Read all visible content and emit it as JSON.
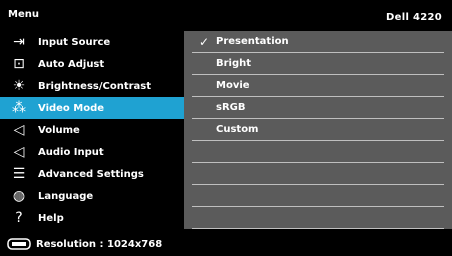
{
  "header": {
    "title": "Menu",
    "model": "Dell 4220"
  },
  "menu": [
    {
      "label": "Input Source",
      "icon": "input-source-icon",
      "glyph": "⇥"
    },
    {
      "label": "Auto Adjust",
      "icon": "auto-adjust-icon",
      "glyph": "⊡"
    },
    {
      "label": "Brightness/Contrast",
      "icon": "brightness-icon",
      "glyph": "☀"
    },
    {
      "label": "Video Mode",
      "icon": "video-mode-icon",
      "glyph": "⁂",
      "selected": true
    },
    {
      "label": "Volume",
      "icon": "volume-icon",
      "glyph": "◁"
    },
    {
      "label": "Audio Input",
      "icon": "audio-input-icon",
      "glyph": "◁"
    },
    {
      "label": "Advanced Settings",
      "icon": "advanced-settings-icon",
      "glyph": "☰"
    },
    {
      "label": "Language",
      "icon": "language-icon",
      "glyph": "◍"
    },
    {
      "label": "Help",
      "icon": "help-icon",
      "glyph": "?"
    }
  ],
  "submenu": {
    "items": [
      {
        "label": "Presentation",
        "checked": true
      },
      {
        "label": "Bright",
        "checked": false
      },
      {
        "label": "Movie",
        "checked": false
      },
      {
        "label": "sRGB",
        "checked": false
      },
      {
        "label": "Custom",
        "checked": false
      },
      {
        "label": "",
        "checked": false
      },
      {
        "label": "",
        "checked": false
      },
      {
        "label": "",
        "checked": false
      },
      {
        "label": "",
        "checked": false
      }
    ],
    "check_glyph": "✓"
  },
  "footer": {
    "resolution_text": "Resolution : 1024x768"
  },
  "colors": {
    "background": "#000000",
    "selected": "#1fa2d2",
    "panel": "#5b5b5b",
    "divider": "#bfbfbf"
  }
}
